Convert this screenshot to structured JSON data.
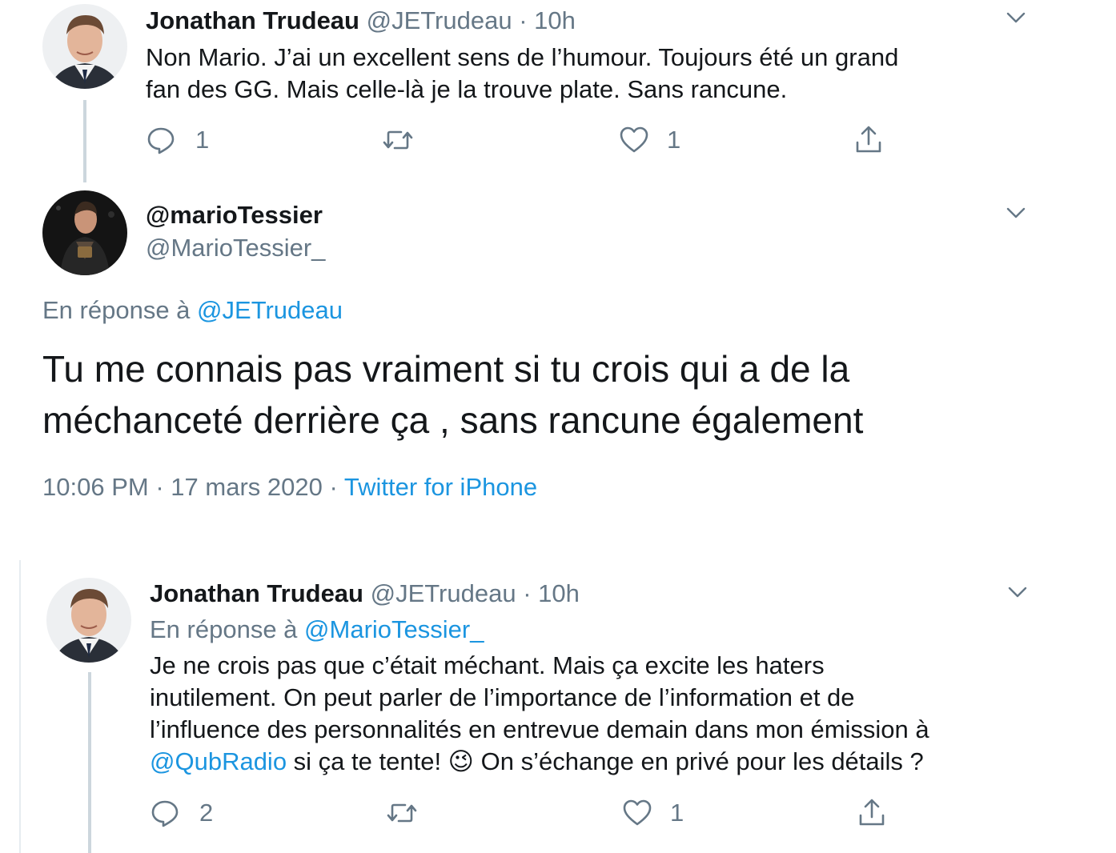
{
  "tweet1": {
    "name": "Jonathan Trudeau",
    "handle": "@JETrudeau",
    "sep": "·",
    "time": "10h",
    "text_lines": [
      "Non Mario. J’ai un excellent sens de l’humour. Toujours été un grand",
      "fan des GG. Mais celle-là je la trouve plate. Sans rancune."
    ],
    "reply_count": "1",
    "like_count": "1"
  },
  "main_tweet": {
    "display_name": "@marioTessier",
    "handle": "@MarioTessier_",
    "reply_prefix": "En réponse à",
    "reply_to": "@JETrudeau",
    "text_lines": [
      "Tu me connais pas vraiment si tu crois qui a de la",
      "méchanceté derrière ça , sans rancune également"
    ],
    "time": "10:06 PM",
    "sep1": "·",
    "date": "17 mars 2020",
    "sep2": "·",
    "source": "Twitter for iPhone"
  },
  "tweet3": {
    "name": "Jonathan Trudeau",
    "handle": "@JETrudeau",
    "sep": "·",
    "time": "10h",
    "reply_prefix": "En réponse à",
    "reply_to": "@MarioTessier_",
    "text_lines": [
      "Je ne crois pas que c’était méchant. Mais ça excite les haters",
      "inutilement. On peut parler de l’importance de l’information et de",
      "l’influence des personnalités en entrevue demain dans mon émission à"
    ],
    "mention": "@QubRadio",
    "last_line_mid": " si ça te tente! ",
    "emoji": "😉",
    "last_line_end": " On s’échange en privé pour les détails ?",
    "reply_count": "2",
    "like_count": "1"
  },
  "icons": {
    "more": "chevron-down-icon",
    "reply": "reply-bubble-icon",
    "retweet": "retweet-icon",
    "like": "heart-icon",
    "share": "share-icon"
  },
  "colors": {
    "text": "#14171a",
    "secondary": "#657786",
    "link": "#1b95e0",
    "thread_line": "#ccd6dd"
  }
}
